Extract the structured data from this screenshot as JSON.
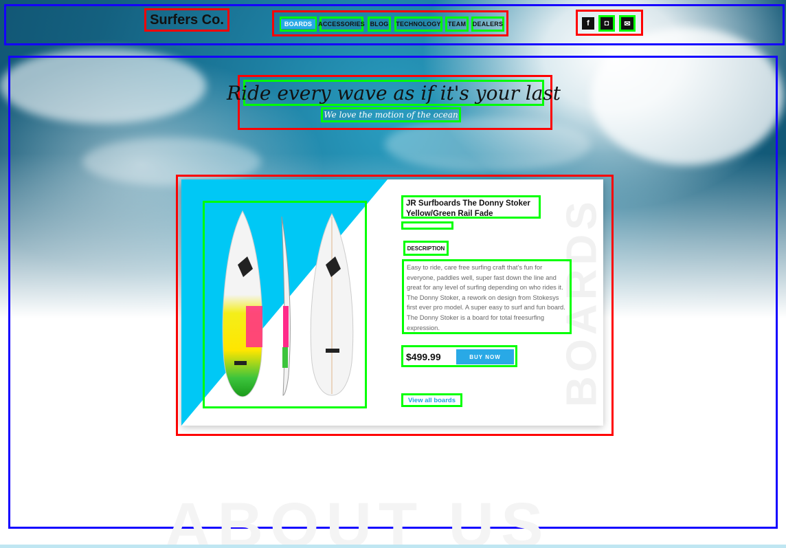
{
  "brand": {
    "name": "Surfers Co."
  },
  "nav": {
    "items": [
      {
        "label": "BOARDS"
      },
      {
        "label": "ACCESSORIES"
      },
      {
        "label": "BLOG"
      },
      {
        "label": "TECHNOLOGY"
      },
      {
        "label": "TEAM"
      },
      {
        "label": "DEALERS"
      }
    ],
    "active": "BOARDS"
  },
  "social": [
    {
      "icon": "facebook-icon",
      "glyph": "f"
    },
    {
      "icon": "instagram-icon",
      "glyph": "◘"
    },
    {
      "icon": "mail-icon",
      "glyph": "✉"
    }
  ],
  "hero": {
    "title": "Ride every wave as if it's your last",
    "subtitle": "We love the motion of the ocean"
  },
  "product": {
    "title": "JR Surfboards The Donny Stoker Yellow/Green Rail Fade",
    "description_heading": "DESCRIPTION",
    "description": "Easy to ride, care free surfing craft that's fun for everyone, paddles well, super fast down the line and great for any level of surfing depending on who rides it. The Donny Stoker, a rework on design from Stokesys first ever pro model. A super easy to surf and fun board. The Donny Stoker is a board for total freesurfing expression.",
    "price": "$499.99",
    "buy_label": "BUY NOW",
    "view_all": "View all boards",
    "section_watermark": "BOARDS"
  },
  "about": {
    "watermark": "ABOUT US"
  },
  "colors": {
    "accent": "#29a9e6",
    "triangle": "#00c8f5"
  }
}
